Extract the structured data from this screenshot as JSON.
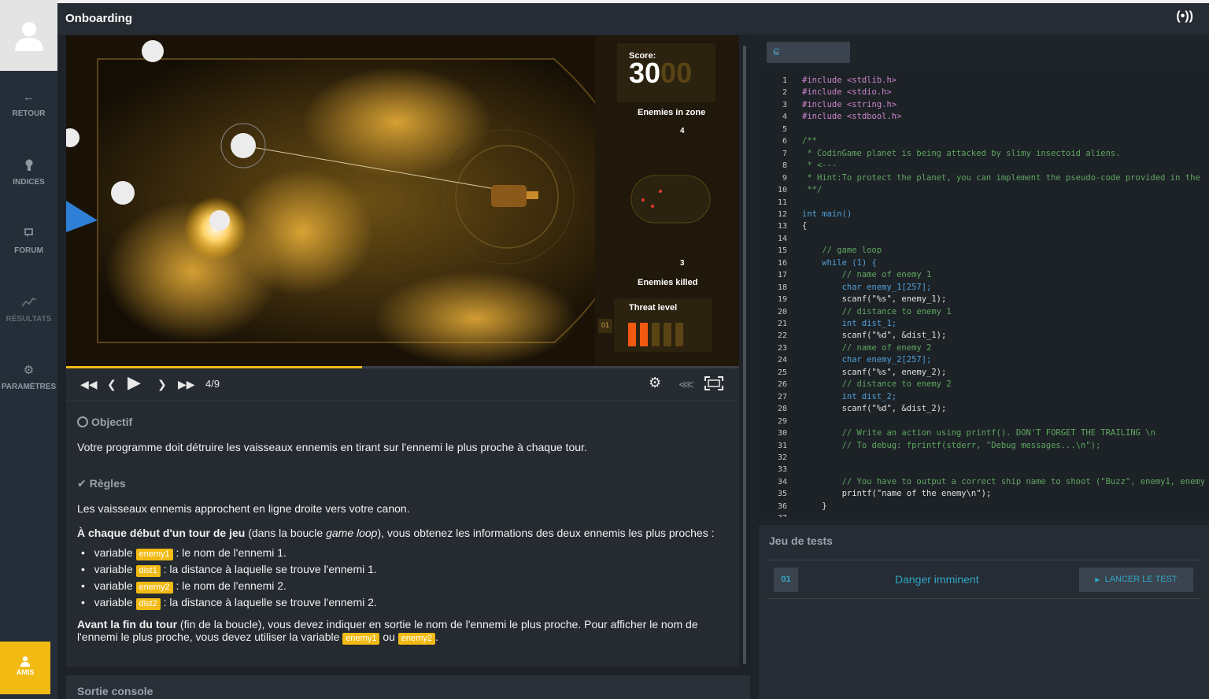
{
  "topbar": {
    "title": "Onboarding"
  },
  "sidebar": {
    "items": [
      {
        "label": "RETOUR",
        "icon": "arrow-left-icon"
      },
      {
        "label": "INDICES",
        "icon": "lightbulb-icon"
      },
      {
        "label": "FORUM",
        "icon": "chat-icon"
      },
      {
        "label": "RÉSULTATS",
        "icon": "chart-icon"
      },
      {
        "label": "PARAMÈTRES",
        "icon": "gear-icon"
      }
    ],
    "friends": "AMIS"
  },
  "game": {
    "score_label": "Score:",
    "score_value": "30",
    "score_ghost": "00",
    "enemies_in_zone_label": "Enemies in zone",
    "enemies_in_zone": "4",
    "enemies_killed_label": "Enemies killed",
    "enemies_killed": "3",
    "threat_label": "Threat level",
    "threat_index": "01",
    "progress": 0.44
  },
  "player": {
    "frame": "4/9"
  },
  "objective": {
    "title": "Objectif",
    "text": "Votre programme doit détruire les vaisseaux ennemis en tirant sur l'ennemi le plus proche à chaque tour."
  },
  "rules": {
    "title": "Règles",
    "intro": "Les vaisseaux ennemis approchent en ligne droite vers votre canon.",
    "bold1": "À chaque début d'un tour de jeu",
    "mid1": " (dans la boucle ",
    "italic1": "game loop",
    "end1": "), vous obtenez les informations des deux ennemis les plus proches :",
    "bullets": [
      {
        "prefix": "variable",
        "tag": "enemy1",
        "text": ": le nom de l'ennemi 1."
      },
      {
        "prefix": "variable",
        "tag": "dist1",
        "text": ": la distance à laquelle se trouve l'ennemi 1."
      },
      {
        "prefix": "variable",
        "tag": "enemy2",
        "text": ": le nom de l'ennemi 2."
      },
      {
        "prefix": "variable",
        "tag": "dist2",
        "text": ": la distance à laquelle se trouve l'ennemi 2."
      }
    ],
    "bold2": "Avant la fin du tour",
    "text2a": " (fin de la boucle), vous devez indiquer en sortie le nom de l'ennemi le plus proche. Pour afficher le nom de",
    "text2b": "l'ennemi le plus proche, vous devez utiliser la variable",
    "tag_a": "enemy1",
    "or": "ou",
    "tag_b": "enemy2",
    "dot": "."
  },
  "console": {
    "title": "Sortie console"
  },
  "editor": {
    "language": "C",
    "lines": [
      "#include <stdlib.h>",
      "#include <stdio.h>",
      "#include <string.h>",
      "#include <stdbool.h>",
      "",
      "/**",
      " * CodinGame planet is being attacked by slimy insectoid aliens.",
      " * <---",
      " * Hint:To protect the planet, you can implement the pseudo-code provided in the",
      " **/",
      "",
      "int main()",
      "{",
      "",
      "    // game loop",
      "    while (1) {",
      "        // name of enemy 1",
      "        char enemy_1[257];",
      "        scanf(\"%s\", enemy_1);",
      "        // distance to enemy 1",
      "        int dist_1;",
      "        scanf(\"%d\", &dist_1);",
      "        // name of enemy 2",
      "        char enemy_2[257];",
      "        scanf(\"%s\", enemy_2);",
      "        // distance to enemy 2",
      "        int dist_2;",
      "        scanf(\"%d\", &dist_2);",
      "",
      "        // Write an action using printf(). DON'T FORGET THE TRAILING \\n",
      "        // To debug: fprintf(stderr, \"Debug messages...\\n\");",
      "",
      "",
      "        // You have to output a correct ship name to shoot (\"Buzz\", enemy1, enemy",
      "        printf(\"name of the enemy\\n\");",
      "    }",
      ""
    ]
  },
  "tests": {
    "title": "Jeu de tests",
    "number": "01",
    "name": "Danger imminent",
    "button": "LANCER LE TEST"
  }
}
